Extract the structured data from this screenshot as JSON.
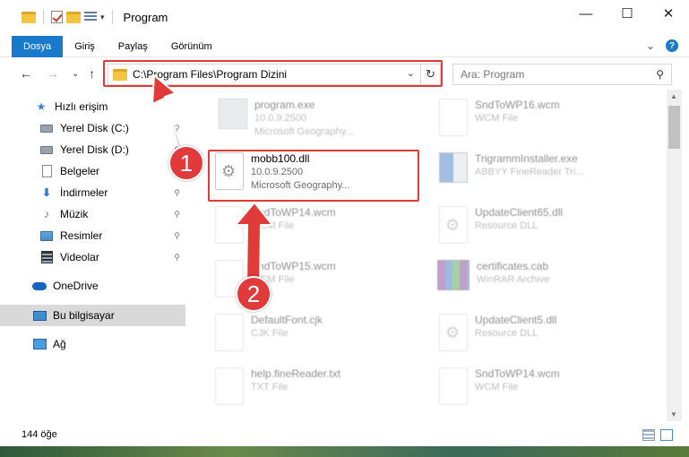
{
  "window": {
    "title": "Program",
    "controls": {
      "minimize": "—",
      "maximize": "☐",
      "close": "✕"
    }
  },
  "ribbon": {
    "tabs": [
      "Dosya",
      "Giriş",
      "Paylaş",
      "Görünüm"
    ],
    "active_tab": "Dosya",
    "expand_glyph": "⌄",
    "help_glyph": "?"
  },
  "nav": {
    "back": "←",
    "forward": "→",
    "recent": "⌄",
    "up": "↑",
    "address": "C:\\Program Files\\Program Dizini",
    "address_dropdown": "⌄",
    "refresh": "↻",
    "search_placeholder": "Ara: Program",
    "search_glyph": "⚲"
  },
  "sidebar": {
    "items": [
      {
        "label": "Hızlı erişim",
        "icon": "star-icon",
        "glyph": "★",
        "pinned": false
      },
      {
        "label": "Yerel Disk (C:)",
        "icon": "drive-icon",
        "glyph": "",
        "pinned": true
      },
      {
        "label": "Yerel Disk (D:)",
        "icon": "drive-icon",
        "glyph": "",
        "pinned": true
      },
      {
        "label": "Belgeler",
        "icon": "documents-icon",
        "glyph": "",
        "pinned": true
      },
      {
        "label": "İndirmeler",
        "icon": "download-icon",
        "glyph": "⬇",
        "pinned": true
      },
      {
        "label": "Müzik",
        "icon": "music-icon",
        "glyph": "♪",
        "pinned": true
      },
      {
        "label": "Resimler",
        "icon": "pictures-icon",
        "glyph": "",
        "pinned": true
      },
      {
        "label": "Videolar",
        "icon": "videos-icon",
        "glyph": "",
        "pinned": true
      },
      {
        "label": "OneDrive",
        "icon": "onedrive-icon",
        "glyph": "",
        "pinned": false
      },
      {
        "label": "Bu bilgisayar",
        "icon": "this-pc-icon",
        "glyph": "",
        "pinned": false
      },
      {
        "label": "Ağ",
        "icon": "network-icon",
        "glyph": "",
        "pinned": false
      }
    ],
    "pin_glyph": "📌",
    "selected": "Bu bilgisayar"
  },
  "files": [
    {
      "name": "program.exe",
      "line2": "10.0.9.2500",
      "line3": "Microsoft Geography...",
      "icon": "exe-icon",
      "highlighted": false
    },
    {
      "name": "SndToWP16.wcm",
      "line2": "WCM File",
      "line3": "",
      "icon": "file-icon",
      "highlighted": false
    },
    {
      "name": "mobb100.dll",
      "line2": "10.0.9.2500",
      "line3": "Microsoft Geography...",
      "icon": "dll-icon",
      "highlighted": true
    },
    {
      "name": "TrigrammInstaller.exe",
      "line2": "ABBYY FineReader Tri...",
      "line3": "",
      "icon": "installer-icon",
      "highlighted": false
    },
    {
      "name": "SndToWP14.wcm",
      "line2": "WCM File",
      "line3": "",
      "icon": "file-icon",
      "highlighted": false
    },
    {
      "name": "UpdateClient65.dll",
      "line2": "Resource DLL",
      "line3": "",
      "icon": "dll-icon",
      "highlighted": false
    },
    {
      "name": "SndToWP15.wcm",
      "line2": "WCM File",
      "line3": "",
      "icon": "file-icon",
      "highlighted": false
    },
    {
      "name": "certificates.cab",
      "line2": "WinRAR Archive",
      "line3": "",
      "icon": "archive-icon",
      "highlighted": false
    },
    {
      "name": "DefaultFont.cjk",
      "line2": "CJK File",
      "line3": "",
      "icon": "file-icon",
      "highlighted": false
    },
    {
      "name": "UpdateClient5.dll",
      "line2": "Resource DLL",
      "line3": "",
      "icon": "dll-icon",
      "highlighted": false
    },
    {
      "name": "help.fineReader.txt",
      "line2": "TXT File",
      "line3": "",
      "icon": "file-icon",
      "highlighted": false
    },
    {
      "name": "SndToWP14.wcm",
      "line2": "WCM File",
      "line3": "",
      "icon": "file-icon",
      "highlighted": false
    }
  ],
  "status": {
    "item_count": "144 öğe"
  },
  "annotations": {
    "step1": "1",
    "step2": "2",
    "color": "#e03a3a"
  }
}
